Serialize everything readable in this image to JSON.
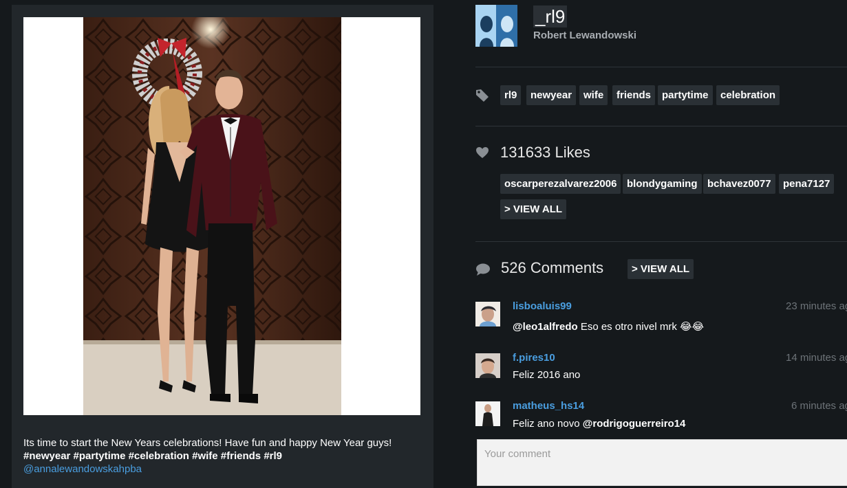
{
  "post": {
    "caption_text": "Its time to start the New Years celebrations! Have fun and happy New Year guys!",
    "caption_tags": "#newyear #partytime #celebration #wife #friends #rl9",
    "caption_mention": "@annalewandowskahpba"
  },
  "profile": {
    "username": "_rl9",
    "full_name": "Robert Lewandowski"
  },
  "tags": [
    "rl9",
    "newyear",
    "wife",
    "friends",
    "partytime",
    "celebration"
  ],
  "likes": {
    "count_label": "131633 Likes",
    "users": [
      "oscarperezalvarez2006",
      "blondygaming",
      "bchavez0077",
      "pena7127"
    ],
    "view_all": "> VIEW ALL"
  },
  "comments": {
    "count_label": "526 Comments",
    "view_all": "> VIEW ALL",
    "items": [
      {
        "user": "lisboaluis99",
        "time": "23 minutes ag",
        "mention": "@leo1alfredo",
        "text": " Eso es otro nivel mrk ",
        "emoji": "😂😂"
      },
      {
        "user": "f.pires10",
        "time": "14 minutes ag",
        "text": "Feliz 2016 ano"
      },
      {
        "user": "matheus_hs14",
        "time": "6 minutes ag",
        "text": "Feliz ano novo ",
        "mention": "@rodrigoguerreiro14"
      }
    ],
    "input_placeholder": "Your comment"
  },
  "colors": {
    "background": "#15191c",
    "panel": "#22272b",
    "chip": "#2a3035",
    "link": "#4a9ee0"
  },
  "icons": [
    "tag-icon",
    "heart-icon",
    "comment-bubble-icon"
  ]
}
